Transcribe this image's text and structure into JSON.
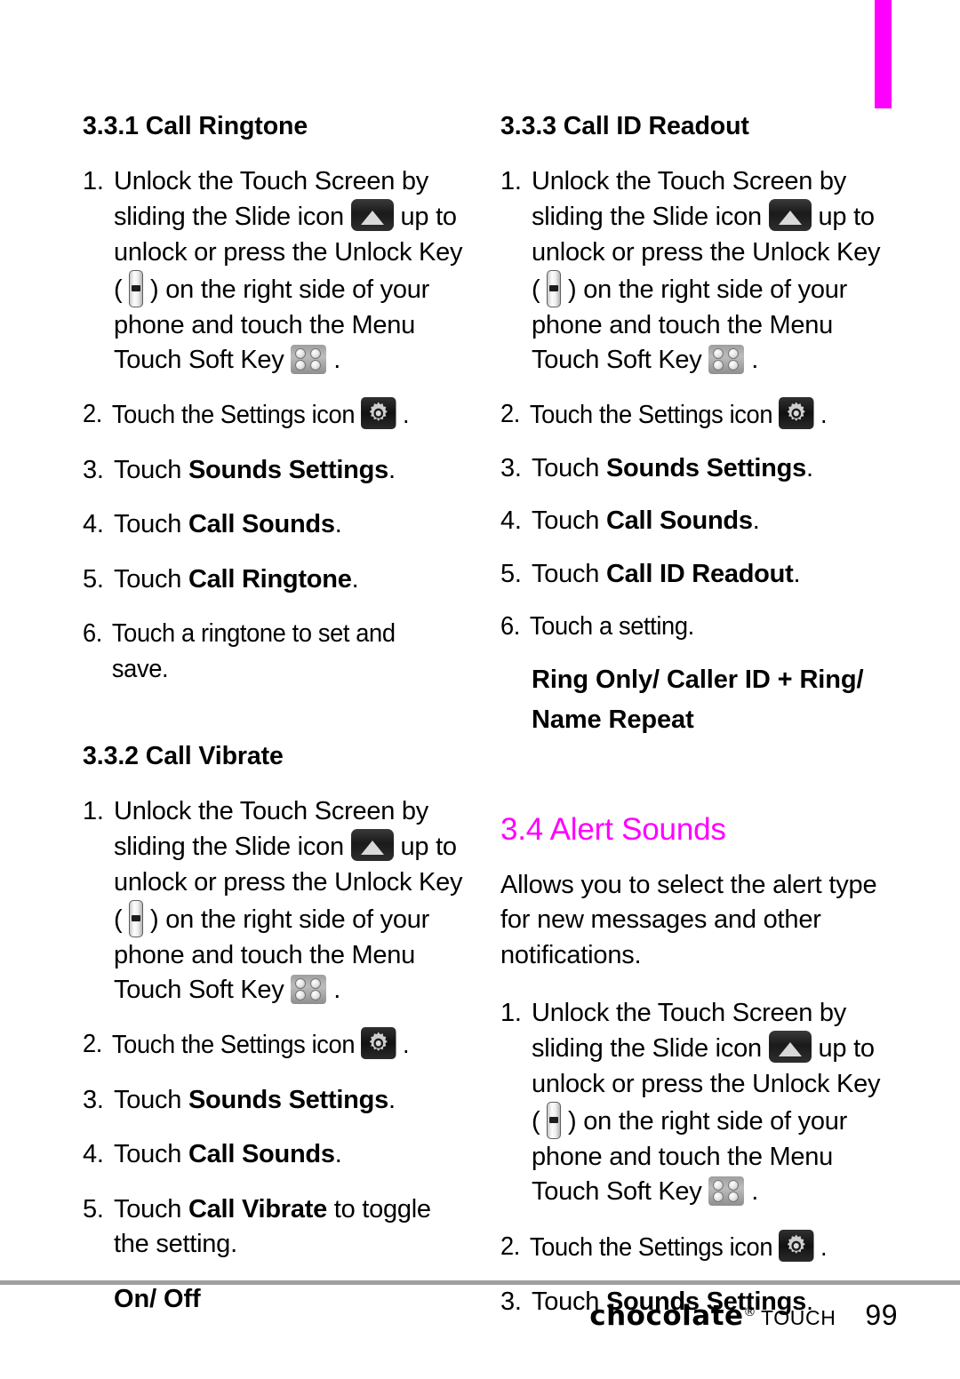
{
  "page": {
    "number": "99",
    "tab_color": "#ff00ff",
    "rule_color": "#a0a0a0"
  },
  "footer": {
    "brand": "chocolate",
    "brand_registered": "®",
    "brand_sub": "TOUCH",
    "page_number": "99"
  },
  "icons": {
    "slide": "slide-icon",
    "menu_soft_key": "menu-touch-soft-key-icon",
    "settings": "settings-gear-icon",
    "unlock_key": "unlock-side-key-icon"
  },
  "common": {
    "step1_a": "Unlock the Touch Screen by sliding the Slide icon",
    "step1_b": "up to unlock or press the Unlock Key (",
    "step1_c": ") on the right side of your phone and touch the Menu Touch Soft Key",
    "step1_d": ".",
    "step2_a": "Touch the Settings icon",
    "step2_b": ".",
    "num1": "1.",
    "num2": "2.",
    "num3": "3.",
    "num4": "4.",
    "num5": "5.",
    "num6": "6."
  },
  "sections": {
    "call_ringtone": {
      "heading": "3.3.1 Call Ringtone",
      "step3_pre": "Touch ",
      "step3_bold": "Sounds Settings",
      "step3_post": ".",
      "step4_pre": "Touch ",
      "step4_bold": "Call Sounds",
      "step4_post": ".",
      "step5_pre": "Touch ",
      "step5_bold": "Call Ringtone",
      "step5_post": ".",
      "step6": "Touch a ringtone to set and save."
    },
    "call_vibrate": {
      "heading": "3.3.2 Call Vibrate",
      "step3_pre": "Touch ",
      "step3_bold": "Sounds Settings",
      "step3_post": ".",
      "step4_pre": "Touch ",
      "step4_bold": "Call Sounds",
      "step4_post": ".",
      "step5_pre": "Touch ",
      "step5_bold": "Call Vibrate",
      "step5_post": " to toggle the setting.",
      "values": "On/ Off"
    },
    "call_id_readout": {
      "heading": "3.3.3 Call ID Readout",
      "step3_pre": "Touch ",
      "step3_bold": "Sounds Settings",
      "step3_post": ".",
      "step4_pre": "Touch ",
      "step4_bold": "Call Sounds",
      "step4_post": ".",
      "step5_pre": "Touch ",
      "step5_bold": "Call ID Readout",
      "step5_post": ".",
      "step6": "Touch a setting.",
      "values_line1": "Ring Only/ Caller ID + Ring/",
      "values_line2": "Name Repeat"
    },
    "alert_sounds": {
      "heading": "3.4 Alert Sounds",
      "intro": "Allows you to select the alert type for new messages and other notifications.",
      "step3_pre": "Touch ",
      "step3_bold": "Sounds Settings",
      "step3_post": "."
    }
  }
}
